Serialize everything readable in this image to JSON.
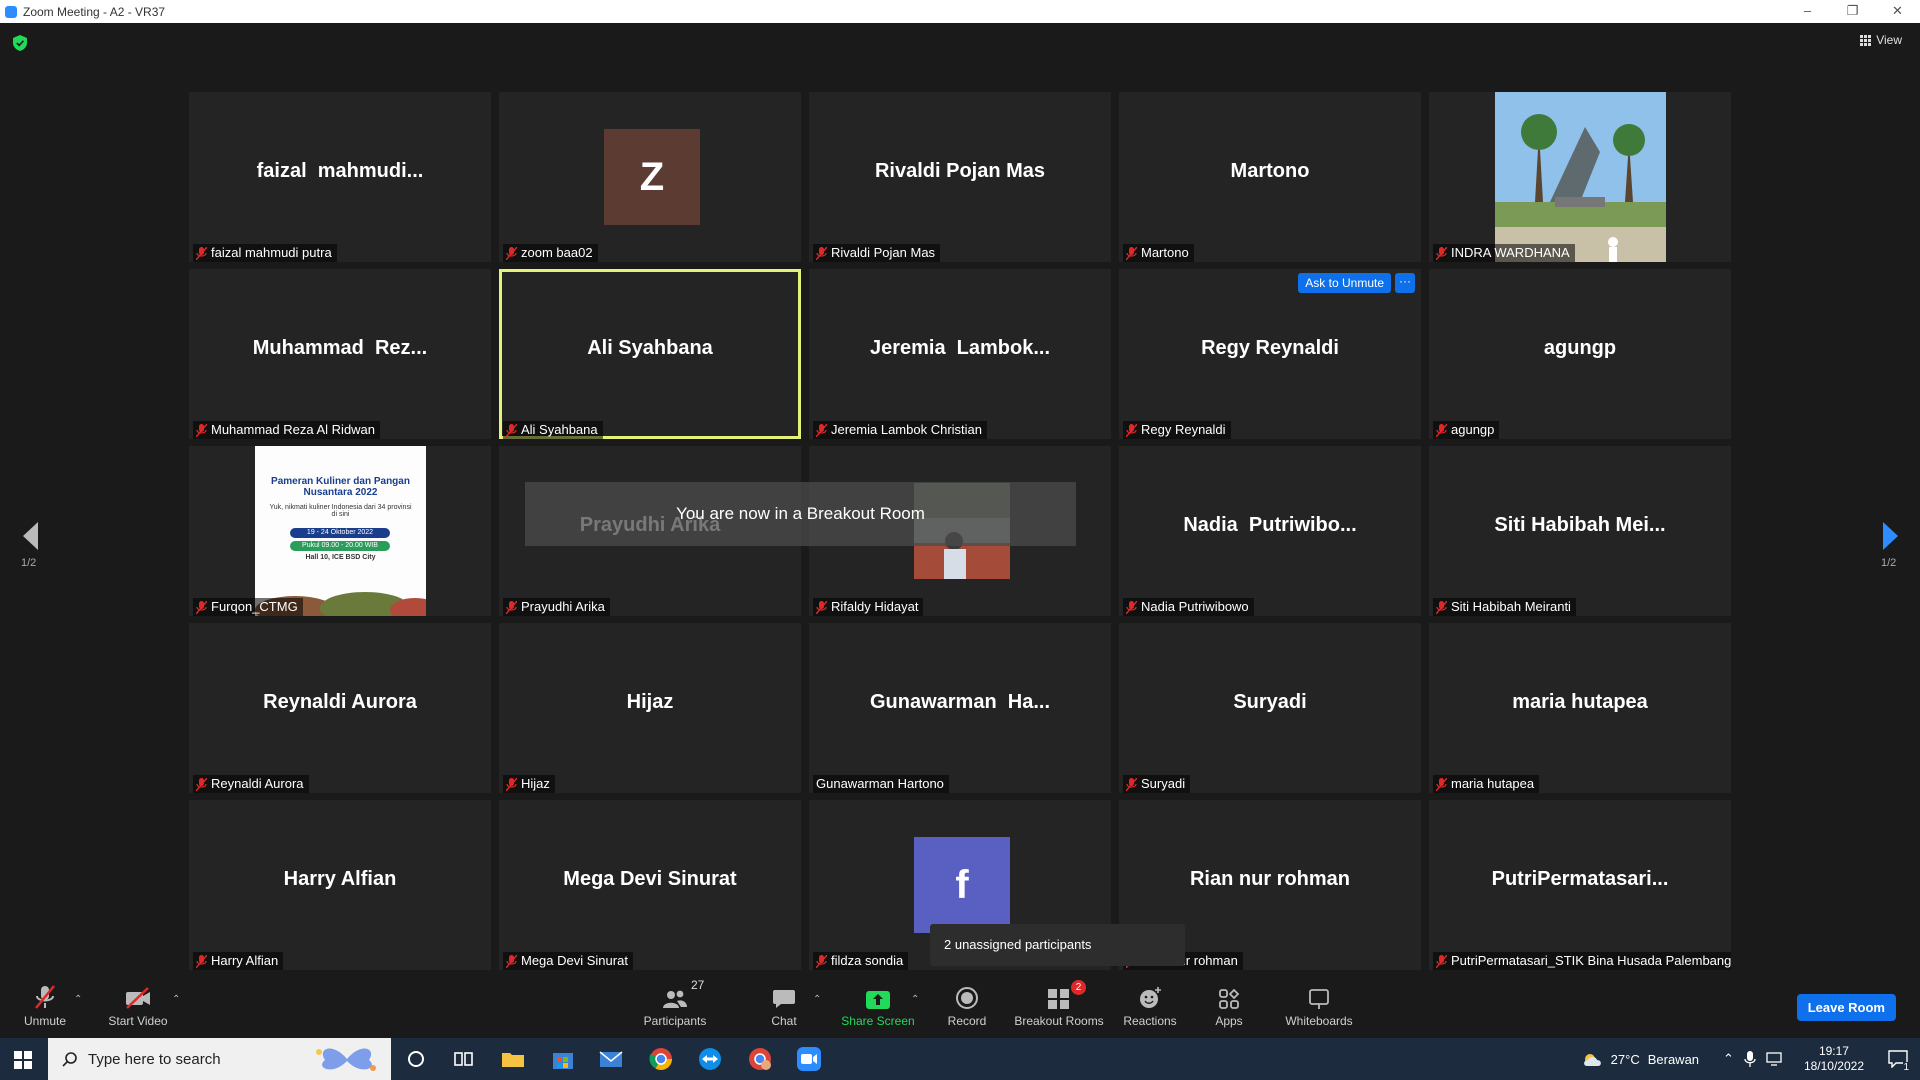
{
  "window": {
    "title": "Zoom Meeting - A2 - VR37",
    "minimize": "–",
    "maximize": "❐",
    "close": "✕"
  },
  "view": {
    "label": "View"
  },
  "participants_grid": [
    {
      "big": "faizal  mahmudi...",
      "label": "faizal mahmudi putra",
      "type": "name"
    },
    {
      "big": "Z",
      "label": "zoom baa02",
      "type": "avatar",
      "avatar_color": "#5c3b33"
    },
    {
      "big": "Rivaldi Pojan Mas",
      "label": "Rivaldi Pojan Mas",
      "type": "name"
    },
    {
      "big": "Martono",
      "label": "Martono",
      "type": "name"
    },
    {
      "big": "",
      "label": "INDRA WARDHANA",
      "type": "photo"
    },
    {
      "big": "Muhammad  Rez...",
      "label": "Muhammad Reza Al Ridwan",
      "type": "name"
    },
    {
      "big": "Ali Syahbana",
      "label": "Ali Syahbana",
      "type": "name",
      "active": true
    },
    {
      "big": "Jeremia  Lambok...",
      "label": "Jeremia Lambok Christian",
      "type": "name"
    },
    {
      "big": "Regy Reynaldi",
      "label": "Regy Reynaldi",
      "type": "name",
      "ask_unmute": "Ask to Unmute",
      "more": "···"
    },
    {
      "big": "agungp",
      "label": "agungp",
      "type": "name"
    },
    {
      "big": "",
      "label": "Furqon_CTMG",
      "type": "poster",
      "poster_title": "Pameran Kuliner dan Pangan Nusantara 2022",
      "poster_sub": "Yuk, nikmati kuliner Indonesia dari 34 provinsi di sini",
      "poster_date1": "19 - 24 Oktober 2022",
      "poster_date2": "Pukul 09.00 - 20.00 WIB",
      "poster_loc": "Hall 10, ICE BSD City"
    },
    {
      "big": "Prayudhi Arika",
      "label": "Prayudhi Arika",
      "type": "name"
    },
    {
      "big": "",
      "label": "Rifaldy Hidayat",
      "type": "photo2"
    },
    {
      "big": "Nadia  Putriwibo...",
      "label": "Nadia Putriwibowo",
      "type": "name"
    },
    {
      "big": "Siti Habibah Mei...",
      "label": "Siti Habibah Meiranti",
      "type": "name"
    },
    {
      "big": "Reynaldi Aurora",
      "label": "Reynaldi Aurora",
      "type": "name"
    },
    {
      "big": "Hijaz",
      "label": "Hijaz",
      "type": "name"
    },
    {
      "big": "Gunawarman  Ha...",
      "label": "Gunawarman Hartono",
      "type": "name",
      "nomic": true
    },
    {
      "big": "Suryadi",
      "label": "Suryadi",
      "type": "name"
    },
    {
      "big": "maria hutapea",
      "label": "maria hutapea",
      "type": "name"
    },
    {
      "big": "Harry Alfian",
      "label": "Harry Alfian",
      "type": "name"
    },
    {
      "big": "Mega Devi Sinurat",
      "label": "Mega Devi Sinurat",
      "type": "name"
    },
    {
      "big": "f",
      "label": "fildza sondia",
      "type": "avatar",
      "avatar_color": "#5a5fc2"
    },
    {
      "big": "Rian nur rohman",
      "label": "Rian nur rohman",
      "type": "name"
    },
    {
      "big": "PutriPermatasari...",
      "label": "PutriPermatasari_STIK Bina Husada Palembang",
      "type": "name"
    }
  ],
  "toast": {
    "text": "You are now in a Breakout Room"
  },
  "unassigned": {
    "text": "2 unassigned participants"
  },
  "pagination": {
    "left": "1/2",
    "right": "1/2"
  },
  "toolbar": {
    "unmute": "Unmute",
    "start_video": "Start Video",
    "participants": "Participants",
    "participants_count": "27",
    "chat": "Chat",
    "share_screen": "Share Screen",
    "record": "Record",
    "breakout_rooms": "Breakout Rooms",
    "breakout_badge": "2",
    "reactions": "Reactions",
    "apps": "Apps",
    "whiteboards": "Whiteboards",
    "leave_room": "Leave Room"
  },
  "taskbar": {
    "search_placeholder": "Type here to search",
    "weather_temp": "27°C",
    "weather_desc": "Berawan",
    "time": "19:17",
    "date": "18/10/2022",
    "notification_count": "1"
  },
  "colors": {
    "accent": "#0e71eb",
    "active_speaker": "#e5f27a",
    "share_green": "#23d959",
    "muted_red": "#e02828"
  }
}
